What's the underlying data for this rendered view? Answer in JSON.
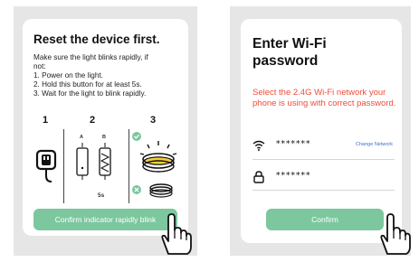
{
  "left": {
    "title": "Reset the device first.",
    "instructions": [
      "Make sure the light blinks rapidly, if",
      "not:",
      "1. Power on the light.",
      "2. Hold this button for at least 5s.",
      "3. Wait for the light to blink rapidly."
    ],
    "steps": [
      "1",
      "2",
      "3"
    ],
    "button_a": "A",
    "button_b": "B",
    "hold_time": "5s",
    "confirm_button": "Confirm indicator rapidly blink"
  },
  "right": {
    "title": "Enter Wi-Fi password",
    "notice": "Select the 2.4G Wi-Fi network your phone is using with correct password.",
    "wifi_value": "*******",
    "change_network": "Change Network",
    "password_value": "*******",
    "confirm_button": "Confirm"
  },
  "colors": {
    "accent_green": "#7cc79e",
    "warning_red": "#f04b3a",
    "link_blue": "#3b6fd6",
    "phone_frame": "#e6e6e6"
  },
  "icons": {
    "wifi": "wifi-icon",
    "lock": "lock-icon",
    "plug": "plug-icon",
    "check": "check-icon",
    "cross": "cross-icon",
    "pointer": "hand-pointer-icon"
  }
}
